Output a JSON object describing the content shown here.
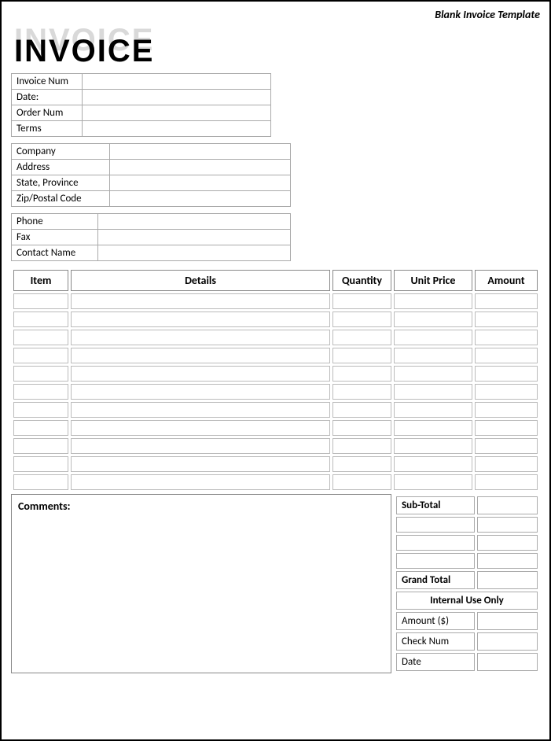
{
  "top_label": "Blank Invoice Template",
  "logo_text": "INVOICE",
  "block1": {
    "invoice_num": "Invoice Num",
    "date": "Date:",
    "order_num": "Order Num",
    "terms": "Terms"
  },
  "block2": {
    "company": "Company",
    "address": "Address",
    "state": "State, Province",
    "zip": "Zip/Postal Code"
  },
  "block3": {
    "phone": "Phone",
    "fax": "Fax",
    "contact": "Contact Name"
  },
  "columns": {
    "item": "Item",
    "details": "Details",
    "quantity": "Quantity",
    "unit_price": "Unit Price",
    "amount": "Amount"
  },
  "comments_label": "Comments:",
  "totals": {
    "sub_total": "Sub-Total",
    "grand_total": "Grand Total",
    "internal": "Internal Use Only",
    "amount": "Amount ($)",
    "check_num": "Check Num",
    "date": "Date"
  }
}
